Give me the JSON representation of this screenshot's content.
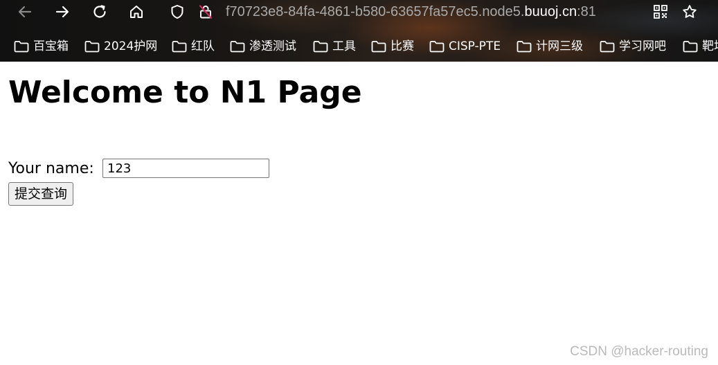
{
  "browser": {
    "url": {
      "prefix": "f70723e8-84fa-4861-b580-63657fa57ec5.node5.",
      "domain": "buuoj.cn",
      "port": ":81"
    },
    "bookmarks": [
      {
        "label": "百宝箱"
      },
      {
        "label": "2024护网"
      },
      {
        "label": "红队"
      },
      {
        "label": "渗透测试"
      },
      {
        "label": "工具"
      },
      {
        "label": "比赛"
      },
      {
        "label": "CISP-PTE"
      },
      {
        "label": "计网三级"
      },
      {
        "label": "学习网吧"
      },
      {
        "label": "靶场"
      }
    ],
    "colors": {
      "icon": "#ffffff",
      "icon_disabled": "#8a8a8a",
      "url_dim": "#a9a9a9",
      "tracking_slash": "#e0245e"
    }
  },
  "page": {
    "title": "Welcome to N1 Page",
    "form": {
      "name_label": "Your name:",
      "name_value": "123",
      "submit_label": "提交查询"
    }
  },
  "watermark": "CSDN @hacker-routing"
}
